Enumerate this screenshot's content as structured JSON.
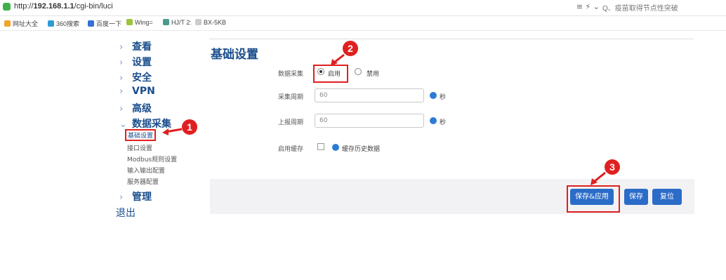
{
  "browser": {
    "url_prefix": "http://",
    "url_host": "192.168.1.1",
    "url_path": "/cgi-bin/luci",
    "search_text": "Q、疫苗取得节点性突破",
    "bookmarks": [
      "网址大全",
      "360搜索",
      "百度一下",
      "Wing=",
      "HJ/T 2:",
      "BX-5KB"
    ]
  },
  "sidebar": {
    "items": [
      "查看",
      "设置",
      "安全",
      "VPN",
      "高级",
      "数据采集"
    ],
    "subitems": [
      "基础设置",
      "接口设置",
      "Modbus规则设置",
      "输入输出配置",
      "服务器配置"
    ],
    "manage": "管理",
    "logout": "退出"
  },
  "main": {
    "title": "基础设置",
    "data_collect_label": "数据采集",
    "enable_label": "启用",
    "disable_label": "禁用",
    "collect_period_label": "采集周期",
    "collect_period_value": "60",
    "report_period_label": "上报周期",
    "report_period_value": "60",
    "seconds": "秒",
    "cache_label": "启用缓存",
    "cache_text": "缓存历史数据"
  },
  "buttons": {
    "save_apply": "保存&应用",
    "save": "保存",
    "reset": "复位"
  },
  "markers": [
    "1",
    "2",
    "3"
  ],
  "colors": {
    "accent": "#1a4e8c",
    "button": "#2b6cc8",
    "annotation": "#e02020"
  }
}
